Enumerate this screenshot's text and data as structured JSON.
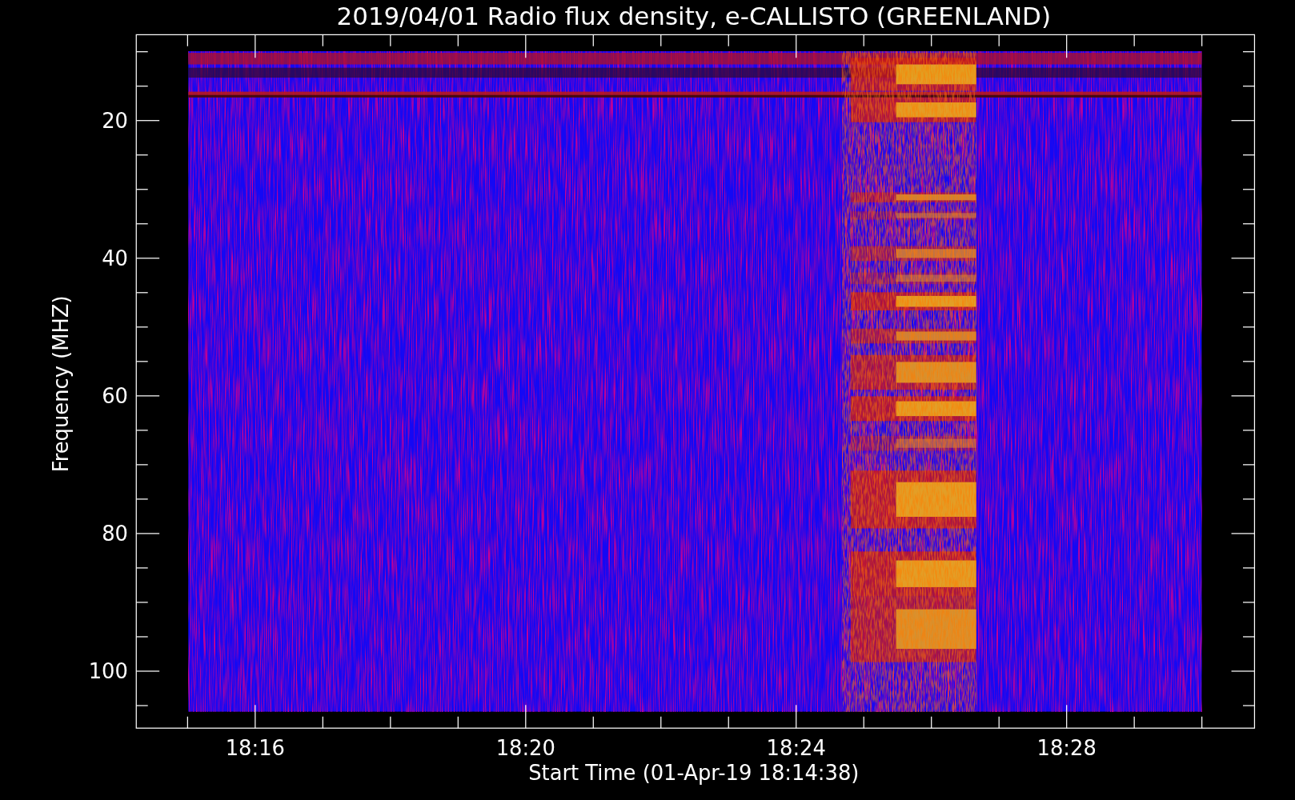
{
  "plot": {
    "title": "2019/04/01  Radio flux density, e-CALLISTO (GREENLAND)",
    "ylabel": "Frequency (MHZ)",
    "xlabel": "Start Time (01-Apr-19 18:14:38)",
    "yticks": [
      "20",
      "40",
      "60",
      "80",
      "100"
    ],
    "xticks": [
      "18:16",
      "18:20",
      "18:24",
      "18:28"
    ]
  }
}
